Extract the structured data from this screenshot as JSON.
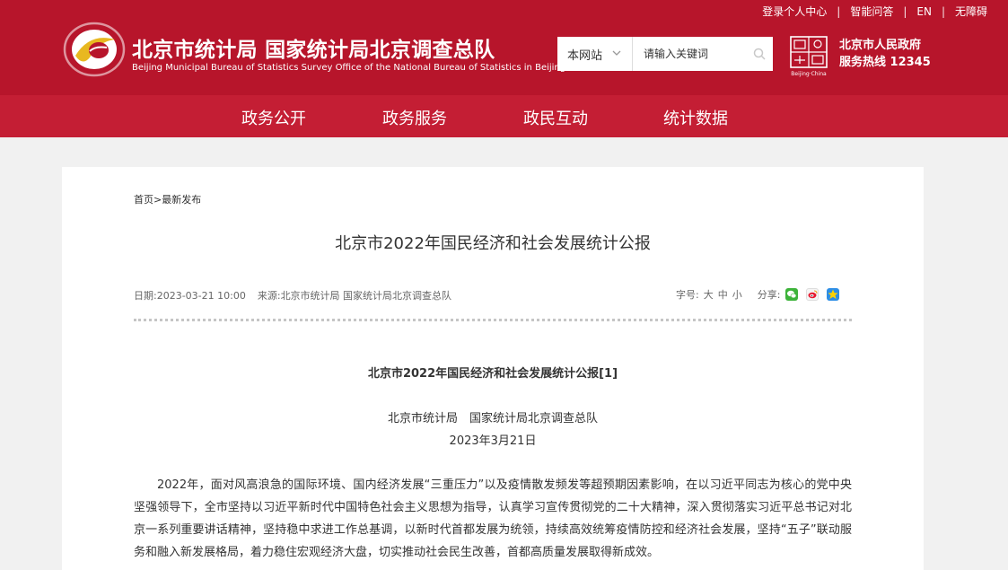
{
  "header": {
    "top_links": [
      "登录个人中心",
      "智能问答",
      "EN",
      "无障碍"
    ],
    "site_title": "北京市统计局 国家统计局北京调查总队",
    "site_subtitle": "Beijing Municipal Bureau of Statistics  Survey Office of the National Bureau of Statistics in Beijing",
    "search": {
      "scope": "本网站",
      "placeholder": "请输入关键词"
    },
    "capital_logo_text": "Beijing·China",
    "hotline_line1": "北京市人民政府",
    "hotline_line2": "服务热线 12345"
  },
  "nav": {
    "items": [
      "政务公开",
      "政务服务",
      "政民互动",
      "统计数据"
    ]
  },
  "breadcrumb": {
    "home": "首页",
    "sep": ">",
    "current": "最新发布"
  },
  "page_title": "北京市2022年国民经济和社会发展统计公报",
  "meta": {
    "date_label": "日期:",
    "date": "2023-03-21 10:00",
    "source_label": "来源:",
    "source": "北京市统计局 国家统计局北京调查总队"
  },
  "tools": {
    "font_label": "字号:",
    "sizes": [
      "大",
      "中",
      "小"
    ],
    "share_label": "分享:",
    "share_icons": [
      "wechat-icon",
      "weibo-icon",
      "qzone-icon"
    ]
  },
  "article": {
    "title": "北京市2022年国民经济和社会发展统计公报[1]",
    "org": "北京市统计局　国家统计局北京调查总队",
    "date": "2023年3月21日",
    "paragraph": "2022年，面对风高浪急的国际环境、国内经济发展“三重压力”以及疫情散发频发等超预期因素影响，在以习近平同志为核心的党中央坚强领导下，全市坚持以习近平新时代中国特色社会主义思想为指导，认真学习宣传贯彻党的二十大精神，深入贯彻落实习近平总书记对北京一系列重要讲话精神，坚持稳中求进工作总基调，以新时代首都发展为统领，持续高效统筹疫情防控和经济社会发展，坚持“五子”联动服务和融入新发展格局，着力稳住宏观经济大盘，切实推动社会民生改善，首都高质量发展取得新成效。"
  },
  "colors": {
    "header_bg": "#b7152b",
    "nav_bg": "#c41e34",
    "page_bg": "#f1f1f1"
  }
}
